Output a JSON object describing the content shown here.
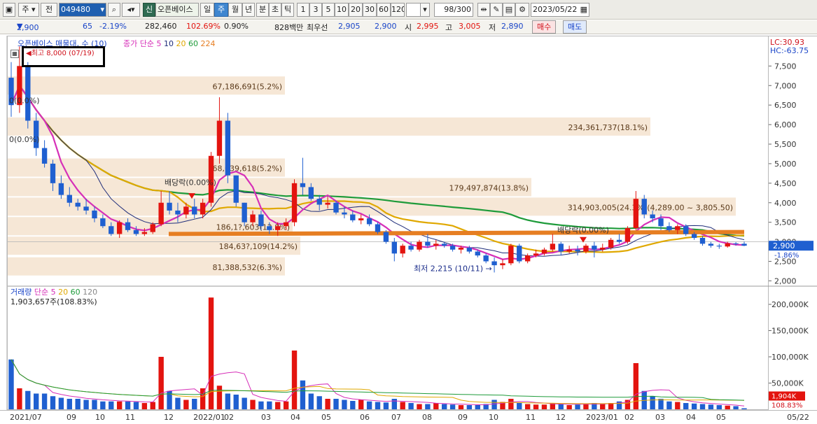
{
  "toolbar": {
    "market": "주",
    "type": "전",
    "code": "049480",
    "stock_name": "오픈베이스",
    "new_badge": "신",
    "periods": [
      "일",
      "주",
      "월",
      "년",
      "분",
      "초",
      "틱"
    ],
    "selected_period": "주",
    "intervals": [
      "1",
      "3",
      "5",
      "10",
      "20",
      "30",
      "60",
      "120"
    ],
    "count_value": "98",
    "count_total": "/300",
    "date": "2023/05/22"
  },
  "pricebar": {
    "price": "2,900",
    "change": "65",
    "change_pct": "-2.19%",
    "volume": "282,460",
    "vol_ratio": "102.69%",
    "turnover": "0.90%",
    "amount": "828백만",
    "best_bid_label": "최우선",
    "best_ask": "2,905",
    "best_bid": "2,900",
    "open_label": "시",
    "open": "2,995",
    "high_label": "고",
    "high": "3,005",
    "low_label": "저",
    "low": "2,890",
    "buy_label": "매수",
    "sell_label": "매도"
  },
  "price_panel": {
    "title": "오픈베이스 매물대, 수 (10)",
    "ma_label": "종가 단순",
    "ma_periods": [
      "5",
      "10",
      "20",
      "60",
      "224"
    ],
    "ma_colors": [
      "#d62fb8",
      "#1f2d7a",
      "#e0a800",
      "#1e9b3a",
      "#e67e22"
    ],
    "high_marker": "최고 8,000 (07/19)",
    "low_marker": "최저 2,215 (10/11)",
    "dividend_labels": [
      "배당락(0.00%)",
      "배당락(0.00%)"
    ],
    "zero_labels": [
      "0(0.0%)",
      "0(0.0%)"
    ],
    "lc_label": "LC:30.93",
    "hc_label": "HC:-63.75",
    "current_price_tag": "2,900",
    "current_pct_tag": "-1.86%",
    "y_ticks": [
      "7,500",
      "7,000",
      "6,500",
      "6,000",
      "5,500",
      "5,000",
      "4,500",
      "4,000",
      "3,500",
      "3,000",
      "2,500",
      "2,000"
    ],
    "volume_profile": [
      {
        "label": "67,186,691(5.2%)",
        "price": 7000
      },
      {
        "label": "234,361,737(18.1%)",
        "price": 5950
      },
      {
        "label": "68,039,618(5.2%)",
        "price": 4900
      },
      {
        "label": "179,497,874(13.8%)",
        "price": 4400
      },
      {
        "label": "314,903,005(24.3%)(4,289.00 ~ 3,805.50)",
        "price": 3900
      },
      {
        "label": "186,1?,603(12.8%)",
        "price": 3400
      },
      {
        "label": "184,63?,109(14.2%)",
        "price": 2900
      },
      {
        "label": "81,388,532(6.3%)",
        "price": 2370
      }
    ]
  },
  "volume_panel": {
    "title": "거래량",
    "ma_label": "단순",
    "ma_periods": [
      "5",
      "20",
      "60",
      "120"
    ],
    "summary": "1,903,657주(108.83%)",
    "y_ticks": [
      "200,000K",
      "150,000K",
      "100,000K",
      "50,000K"
    ],
    "current_tag": "1,904K",
    "current_pct_tag": "108.83%"
  },
  "x_axis": [
    "2021/07",
    "09",
    "10",
    "11",
    "12",
    "2022/01",
    "02",
    "03",
    "04",
    "05",
    "06",
    "07",
    "08",
    "09",
    "10",
    "11",
    "12",
    "2023/01",
    "02",
    "03",
    "04",
    "05",
    "05/22"
  ],
  "chart_data": {
    "type": "candlestick",
    "interval": "weekly",
    "candles": [
      [
        7200,
        7600,
        6200,
        6500
      ],
      [
        6500,
        8000,
        6300,
        7500
      ],
      [
        7500,
        7600,
        5900,
        6100
      ],
      [
        6100,
        6300,
        5200,
        5400
      ],
      [
        5400,
        5600,
        4900,
        5000
      ],
      [
        5000,
        5100,
        4300,
        4500
      ],
      [
        4500,
        4700,
        4100,
        4200
      ],
      [
        4200,
        4400,
        3900,
        4000
      ],
      [
        4000,
        4100,
        3800,
        3900
      ],
      [
        3900,
        4100,
        3700,
        3800
      ],
      [
        3800,
        3900,
        3500,
        3600
      ],
      [
        3600,
        3700,
        3350,
        3400
      ],
      [
        3400,
        3500,
        3150,
        3200
      ],
      [
        3200,
        3550,
        3100,
        3500
      ],
      [
        3500,
        3600,
        3250,
        3300
      ],
      [
        3300,
        3400,
        3150,
        3200
      ],
      [
        3200,
        3350,
        3150,
        3250
      ],
      [
        3250,
        3500,
        3200,
        3450
      ],
      [
        3450,
        4300,
        3400,
        4000
      ],
      [
        4000,
        4300,
        3700,
        3800
      ],
      [
        3800,
        4000,
        3500,
        3700
      ],
      [
        3700,
        4000,
        3600,
        3900
      ],
      [
        3900,
        4100,
        3600,
        3700
      ],
      [
        3700,
        4100,
        3600,
        4000
      ],
      [
        4000,
        5300,
        3900,
        5200
      ],
      [
        5200,
        6700,
        5000,
        6100
      ],
      [
        6100,
        6300,
        4500,
        4700
      ],
      [
        4700,
        4700,
        3900,
        4000
      ],
      [
        4000,
        4000,
        3400,
        3500
      ],
      [
        3500,
        3800,
        3400,
        3700
      ],
      [
        3700,
        3800,
        3300,
        3400
      ],
      [
        3400,
        3500,
        3200,
        3300
      ],
      [
        3300,
        3500,
        3150,
        3400
      ],
      [
        3400,
        3600,
        3300,
        3500
      ],
      [
        3500,
        4600,
        3400,
        4500
      ],
      [
        4500,
        5150,
        4200,
        4400
      ],
      [
        4400,
        4500,
        4050,
        4100
      ],
      [
        4100,
        4200,
        3800,
        3950
      ],
      [
        3950,
        4150,
        3850,
        4000
      ],
      [
        4000,
        4050,
        3700,
        3750
      ],
      [
        3750,
        3900,
        3600,
        3700
      ],
      [
        3700,
        3800,
        3500,
        3550
      ],
      [
        3550,
        3700,
        3450,
        3600
      ],
      [
        3600,
        3700,
        3400,
        3450
      ],
      [
        3450,
        3500,
        3200,
        3250
      ],
      [
        3250,
        3300,
        2950,
        3000
      ],
      [
        3000,
        3100,
        2500,
        2700
      ],
      [
        2700,
        2950,
        2600,
        2900
      ],
      [
        2900,
        3000,
        2750,
        2800
      ],
      [
        2800,
        3050,
        2750,
        3000
      ],
      [
        3000,
        3200,
        2850,
        2900
      ],
      [
        2900,
        3050,
        2800,
        2950
      ],
      [
        2950,
        3000,
        2850,
        2900
      ],
      [
        2900,
        2950,
        2750,
        2800
      ],
      [
        2800,
        2900,
        2700,
        2850
      ],
      [
        2850,
        2900,
        2700,
        2750
      ],
      [
        2750,
        2800,
        2600,
        2650
      ],
      [
        2650,
        2700,
        2450,
        2500
      ],
      [
        2500,
        2600,
        2215,
        2400
      ],
      [
        2400,
        2550,
        2300,
        2450
      ],
      [
        2450,
        2950,
        2400,
        2900
      ],
      [
        2900,
        2950,
        2450,
        2500
      ],
      [
        2500,
        2700,
        2450,
        2650
      ],
      [
        2650,
        2800,
        2600,
        2700
      ],
      [
        2700,
        2850,
        2650,
        2800
      ],
      [
        2800,
        3200,
        2750,
        2950
      ],
      [
        2950,
        3000,
        2650,
        2750
      ],
      [
        2750,
        2900,
        2700,
        2800
      ],
      [
        2800,
        2900,
        2650,
        2750
      ],
      [
        2750,
        2950,
        2700,
        2900
      ],
      [
        2900,
        3000,
        2600,
        2800
      ],
      [
        2800,
        2950,
        2750,
        2850
      ],
      [
        2850,
        3100,
        2800,
        3050
      ],
      [
        3050,
        3200,
        2950,
        3000
      ],
      [
        3000,
        3400,
        2950,
        3350
      ],
      [
        3350,
        4300,
        3300,
        4100
      ],
      [
        4100,
        4200,
        3600,
        3700
      ],
      [
        3700,
        3800,
        3500,
        3600
      ],
      [
        3600,
        3700,
        3300,
        3400
      ],
      [
        3400,
        3500,
        3250,
        3300
      ],
      [
        3300,
        3450,
        3200,
        3400
      ],
      [
        3400,
        3450,
        3150,
        3200
      ],
      [
        3200,
        3250,
        3050,
        3100
      ],
      [
        3100,
        3150,
        2900,
        2950
      ],
      [
        2950,
        3000,
        2850,
        2900
      ],
      [
        2900,
        2950,
        2820,
        2880
      ],
      [
        2880,
        3000,
        2850,
        2960
      ],
      [
        2960,
        2990,
        2900,
        2950
      ],
      [
        2950,
        3005,
        2890,
        2900
      ]
    ],
    "volumes_k": [
      95,
      40,
      35,
      30,
      30,
      25,
      22,
      20,
      20,
      18,
      18,
      15,
      15,
      15,
      15,
      14,
      12,
      14,
      100,
      35,
      22,
      18,
      20,
      40,
      213,
      45,
      30,
      28,
      22,
      18,
      15,
      15,
      14,
      15,
      112,
      55,
      30,
      25,
      20,
      20,
      18,
      16,
      18,
      15,
      14,
      13,
      20,
      14,
      12,
      10,
      10,
      12,
      10,
      9,
      8,
      8,
      8,
      10,
      18,
      14,
      20,
      12,
      10,
      9,
      9,
      12,
      10,
      8,
      9,
      10,
      12,
      11,
      12,
      15,
      18,
      88,
      35,
      25,
      20,
      15,
      14,
      12,
      11,
      10,
      9,
      8,
      7,
      6,
      2
    ]
  }
}
